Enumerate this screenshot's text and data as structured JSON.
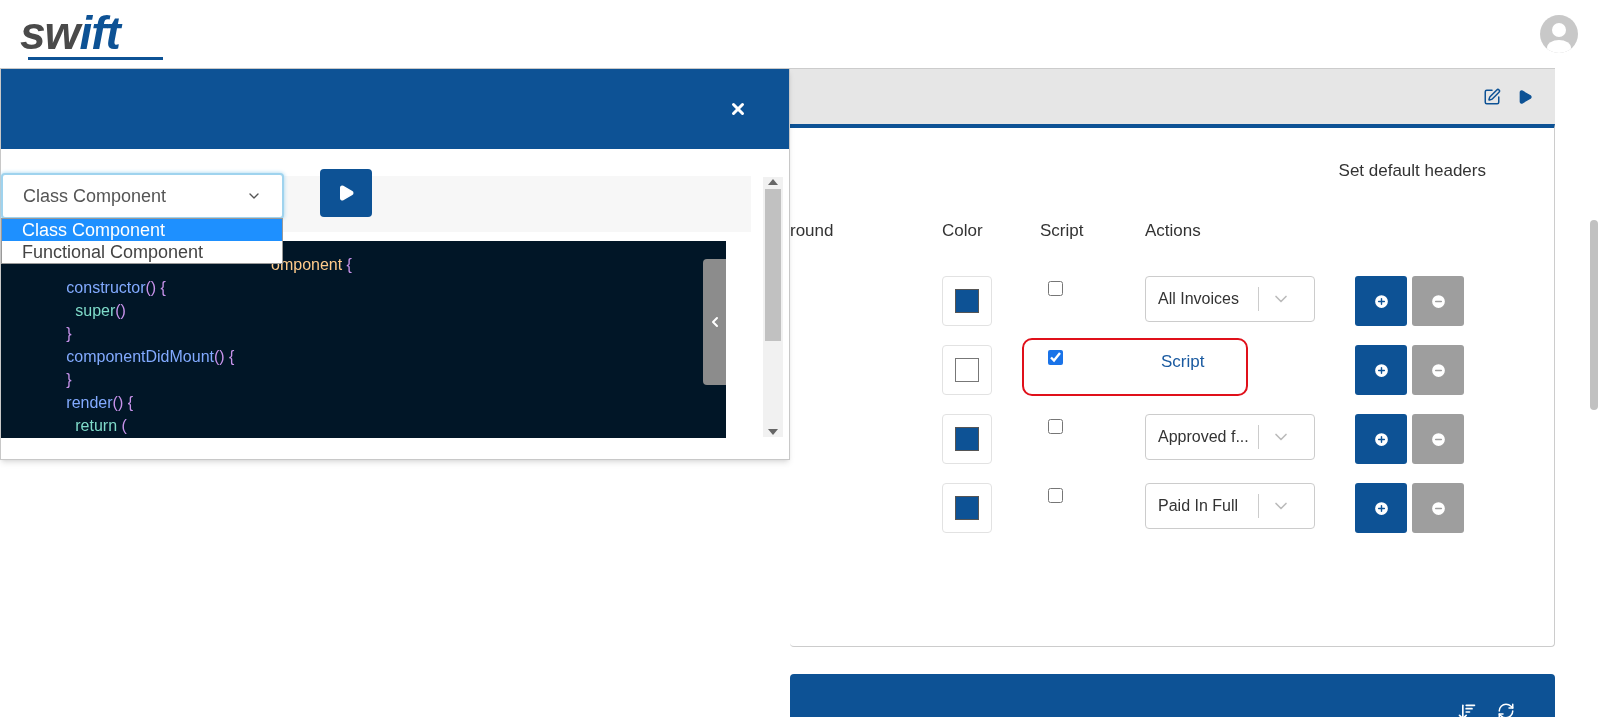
{
  "header": {
    "logo": {
      "dark": "sw",
      "accent": "ift"
    }
  },
  "modal": {
    "language_select": {
      "value": "Class Component",
      "open": true,
      "options": [
        {
          "label": "Class Component",
          "selected": true
        },
        {
          "label": "Functional Component",
          "selected": false
        }
      ]
    },
    "code": [
      [
        {
          "text": "omponent ",
          "kind": "type"
        },
        {
          "text": "{",
          "kind": "punct"
        }
      ],
      [
        {
          "text": "            constructor",
          "kind": "func"
        },
        {
          "text": "() {",
          "kind": "punct"
        }
      ],
      [
        {
          "text": "              super",
          "kind": "call"
        },
        {
          "text": "()",
          "kind": "punct"
        }
      ],
      [
        {
          "text": "            }",
          "kind": "punct"
        }
      ],
      [
        {
          "text": "            componentDidMount",
          "kind": "func"
        },
        {
          "text": "() {",
          "kind": "punct"
        }
      ],
      [
        {
          "text": "            }",
          "kind": "punct"
        }
      ],
      [
        {
          "text": "            render",
          "kind": "func"
        },
        {
          "text": "() {",
          "kind": "punct"
        }
      ],
      [
        {
          "text": "              return ",
          "kind": "call"
        },
        {
          "text": "(",
          "kind": "punct"
        }
      ]
    ]
  },
  "panel": {
    "set_default_headers": "Set default headers",
    "columns": [
      "round",
      "Color",
      "Script",
      "Actions"
    ],
    "rows": [
      {
        "color_filled": true,
        "script": false,
        "action": {
          "kind": "select",
          "text": "All Invoices"
        },
        "highlighted": false
      },
      {
        "color_filled": false,
        "script": true,
        "action": {
          "kind": "link",
          "text": "Script"
        },
        "highlighted": true
      },
      {
        "color_filled": true,
        "script": false,
        "action": {
          "kind": "select",
          "text": "Approved f..."
        },
        "highlighted": false
      },
      {
        "color_filled": true,
        "script": false,
        "action": {
          "kind": "select",
          "text": "Paid In Full"
        },
        "highlighted": false
      }
    ]
  }
}
